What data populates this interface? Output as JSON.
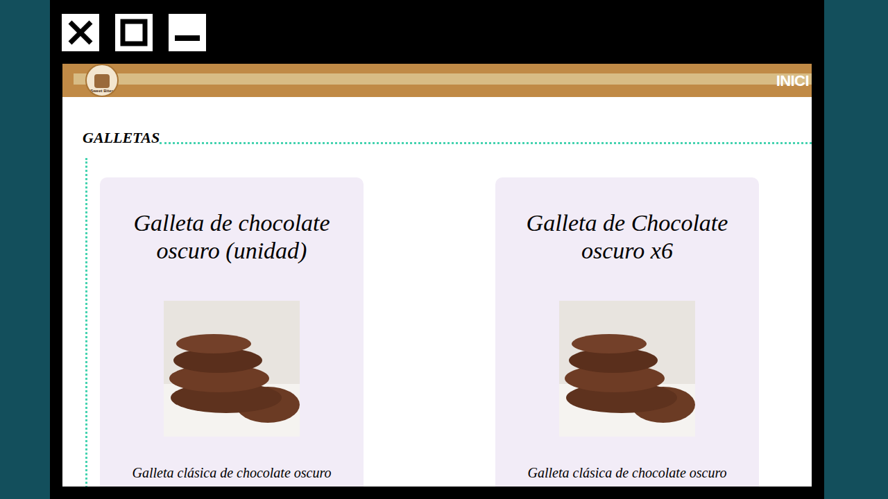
{
  "header": {
    "logo_text": "Sweet Bites",
    "nav": [
      "INICI"
    ]
  },
  "section": {
    "title": "GALLETAS"
  },
  "products": [
    {
      "title": "Galleta de chocolate oscuro (unidad)",
      "description": "Galleta clásica de chocolate oscuro"
    },
    {
      "title": "Galleta de Chocolate oscuro x6",
      "description": "Galleta clásica de chocolate oscuro"
    }
  ]
}
